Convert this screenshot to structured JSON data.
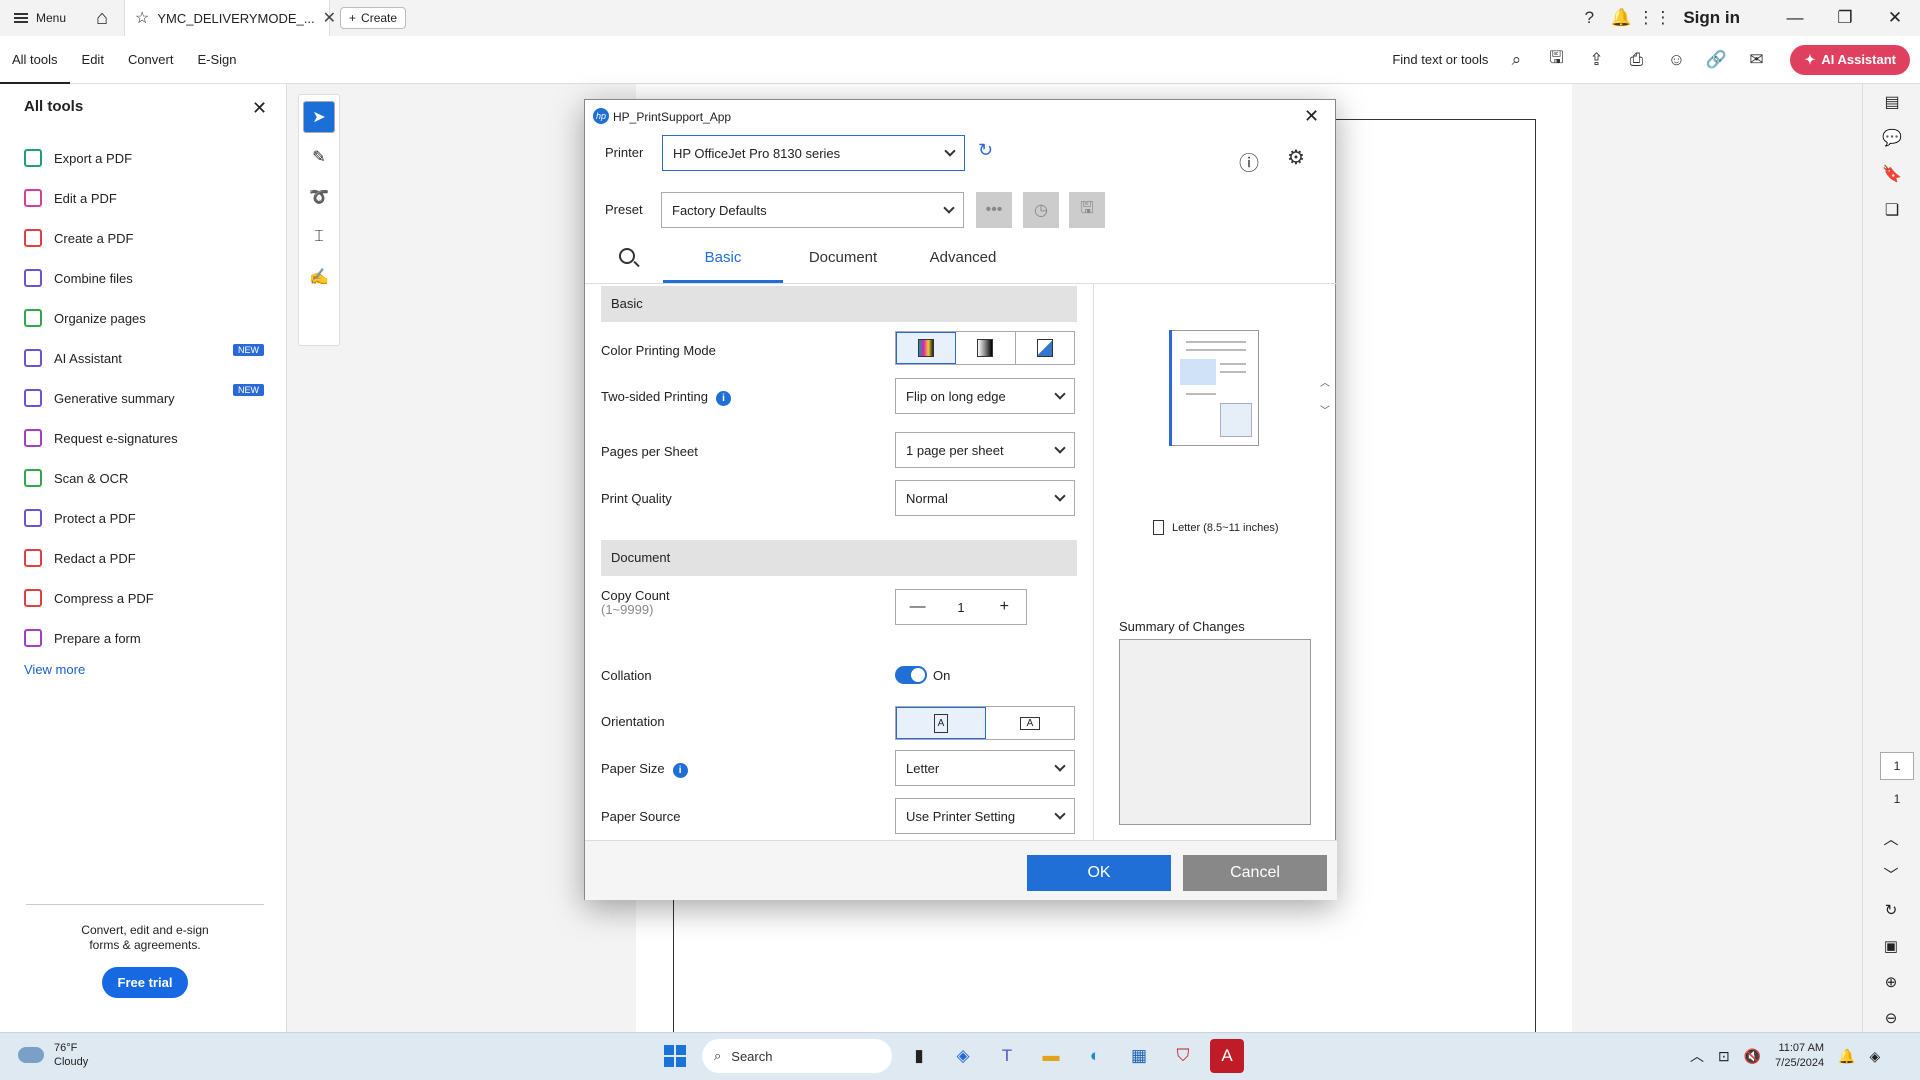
{
  "app": {
    "menu_label": "Menu",
    "doc_tab": "YMC_DELIVERYMODE_...",
    "create_label": "Create",
    "sign_in": "Sign in"
  },
  "toolbar": {
    "items": [
      "All tools",
      "Edit",
      "Convert",
      "E-Sign"
    ],
    "find": "Find text or tools",
    "ai_assistant": "AI Assistant"
  },
  "left_panel": {
    "title": "All tools",
    "items": [
      {
        "label": "Export a PDF",
        "color": "#1f9e7a"
      },
      {
        "label": "Edit a PDF",
        "color": "#d64092"
      },
      {
        "label": "Create a PDF",
        "color": "#e04040"
      },
      {
        "label": "Combine files",
        "color": "#6d52d9"
      },
      {
        "label": "Organize pages",
        "color": "#2ea84a"
      },
      {
        "label": "AI Assistant",
        "color": "#6d52d9",
        "badge": "NEW"
      },
      {
        "label": "Generative summary",
        "color": "#6d52d9",
        "badge": "NEW"
      },
      {
        "label": "Request e-signatures",
        "color": "#a23fc7"
      },
      {
        "label": "Scan & OCR",
        "color": "#2ea84a"
      },
      {
        "label": "Protect a PDF",
        "color": "#6d52d9"
      },
      {
        "label": "Redact a PDF",
        "color": "#e04040"
      },
      {
        "label": "Compress a PDF",
        "color": "#e04040"
      },
      {
        "label": "Prepare a form",
        "color": "#a23fc7"
      }
    ],
    "view_more": "View more",
    "promo_line1": "Convert, edit and e-sign",
    "promo_line2": "forms & agreements.",
    "free_trial": "Free trial"
  },
  "dialog": {
    "title": "HP_PrintSupport_App",
    "printer_label": "Printer",
    "printer_value": "HP OfficeJet Pro 8130 series",
    "preset_label": "Preset",
    "preset_value": "Factory Defaults",
    "tabs": [
      "Basic",
      "Document",
      "Advanced"
    ],
    "active_tab": "Basic",
    "section_basic": "Basic",
    "color_mode_label": "Color Printing Mode",
    "two_sided_label": "Two-sided Printing",
    "two_sided_value": "Flip on long edge",
    "pages_per_sheet_label": "Pages per Sheet",
    "pages_per_sheet_value": "1 page per sheet",
    "print_quality_label": "Print Quality",
    "print_quality_value": "Normal",
    "section_document": "Document",
    "copy_count_label": "Copy Count",
    "copy_count_range": "(1~9999)",
    "copy_count_value": "1",
    "collation_label": "Collation",
    "collation_value": "On",
    "orientation_label": "Orientation",
    "paper_size_label": "Paper Size",
    "paper_size_value": "Letter",
    "paper_source_label": "Paper Source",
    "paper_source_value": "Use Printer Setting",
    "paper_desc": "Letter (8.5~11 inches)",
    "summary_label": "Summary of Changes",
    "ok": "OK",
    "cancel": "Cancel"
  },
  "viewer": {
    "page_current": "1",
    "page_total": "1"
  },
  "taskbar": {
    "temp": "76°F",
    "weather": "Cloudy",
    "search": "Search",
    "time": "11:07 AM",
    "date": "7/25/2024"
  }
}
